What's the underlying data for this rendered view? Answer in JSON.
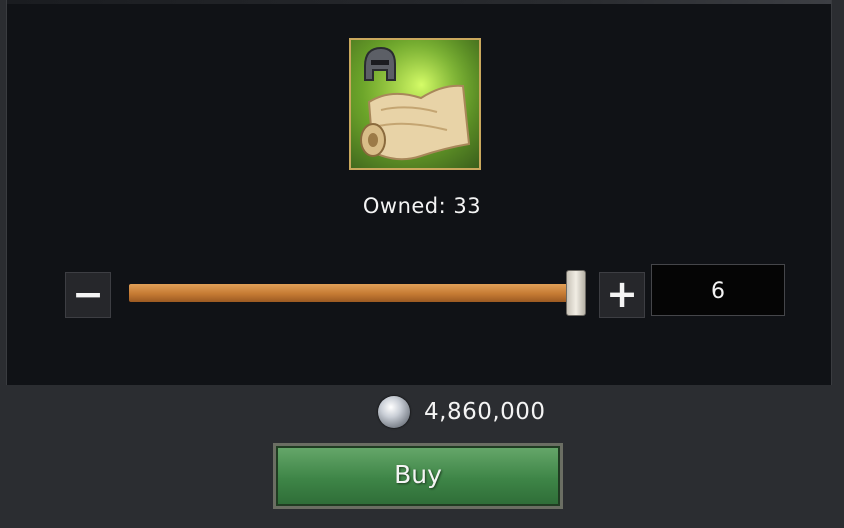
{
  "item": {
    "icon": "scroll-with-helmet-icon",
    "owned_text": "Owned: 33"
  },
  "quantity": {
    "minus_label": "−",
    "plus_label": "+",
    "value": "6",
    "slider_fraction": 1.0
  },
  "cost": {
    "currency_icon": "silver-coin-icon",
    "value": "4,860,000"
  },
  "buy_button": {
    "label": "Buy"
  },
  "colors": {
    "frame_border": "#caa85d",
    "slider_fill": "#c57a33",
    "buy_button": "#3e8547"
  }
}
